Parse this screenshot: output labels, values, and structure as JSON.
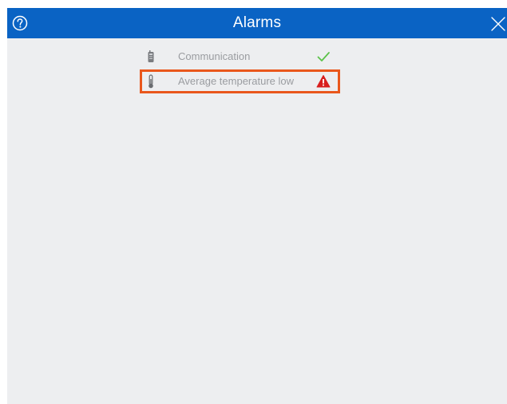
{
  "window": {
    "title": "Alarms",
    "accent_color": "#0a63c4",
    "help_icon": "question-circle-icon",
    "close_icon": "close-x-icon"
  },
  "alarms": [
    {
      "label": "Communication",
      "icon": "device-icon",
      "status": "ok",
      "status_icon": "checkmark-icon",
      "status_color": "#5cc24a",
      "selected": false
    },
    {
      "label": "Average temperature low",
      "icon": "thermometer-icon",
      "status": "warning",
      "status_icon": "warning-triangle-icon",
      "status_color": "#d81e1e",
      "selected": true
    }
  ],
  "selection_color": "#e9571c"
}
